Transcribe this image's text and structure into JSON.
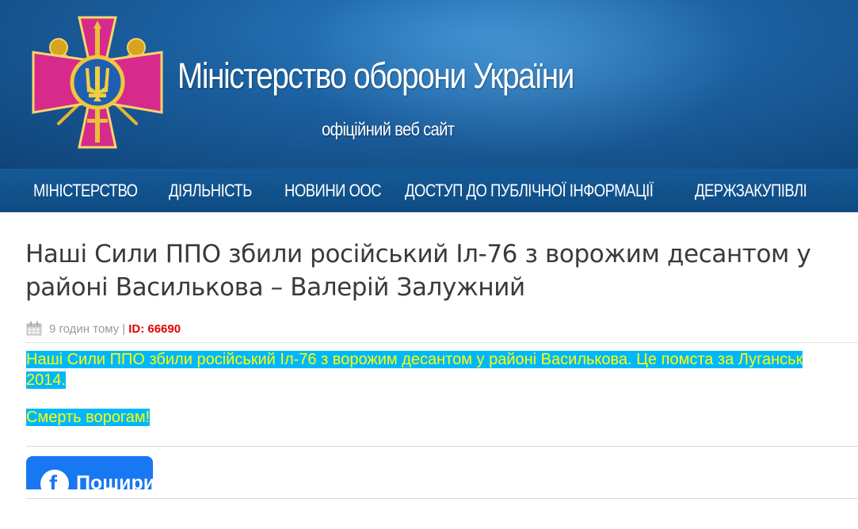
{
  "header": {
    "title": "Міністерство оборони України",
    "subtitle": "офіційний веб сайт",
    "logo": "ministry-of-defence-emblem"
  },
  "nav": {
    "items": [
      {
        "label": "МІНІСТЕРСТВО"
      },
      {
        "label": "ДІЯЛЬНІСТЬ"
      },
      {
        "label": "НОВИНИ ООС"
      },
      {
        "label": "ДОСТУП ДО ПУБЛІЧНОЇ ІНФОРМАЦІЇ"
      },
      {
        "label": "ДЕРЖЗАКУПІВЛІ"
      }
    ]
  },
  "article": {
    "title": "Наші Сили ППО збили російський Іл-76 з ворожим десантом у районі Василькова – Валерій Залужний",
    "meta": {
      "time": "9 годин тому",
      "separator": "|",
      "id": "ID: 66690",
      "icon": "calendar-icon"
    },
    "paragraphs": [
      "Наші Сили ППО збили російський Іл-76 з ворожим десантом у районі Василькова. Це помста за Луганськ 2014.",
      "Смерть ворогам!"
    ]
  },
  "share": {
    "facebook_label": "Поширити",
    "icon": "facebook-icon"
  },
  "colors": {
    "header_blue": "#1b5f9f",
    "nav_blue": "#145a98",
    "highlight_bg": "#00b7ff",
    "highlight_text": "#ffff00",
    "id_red": "#e00000",
    "facebook_blue": "#1877f2"
  }
}
